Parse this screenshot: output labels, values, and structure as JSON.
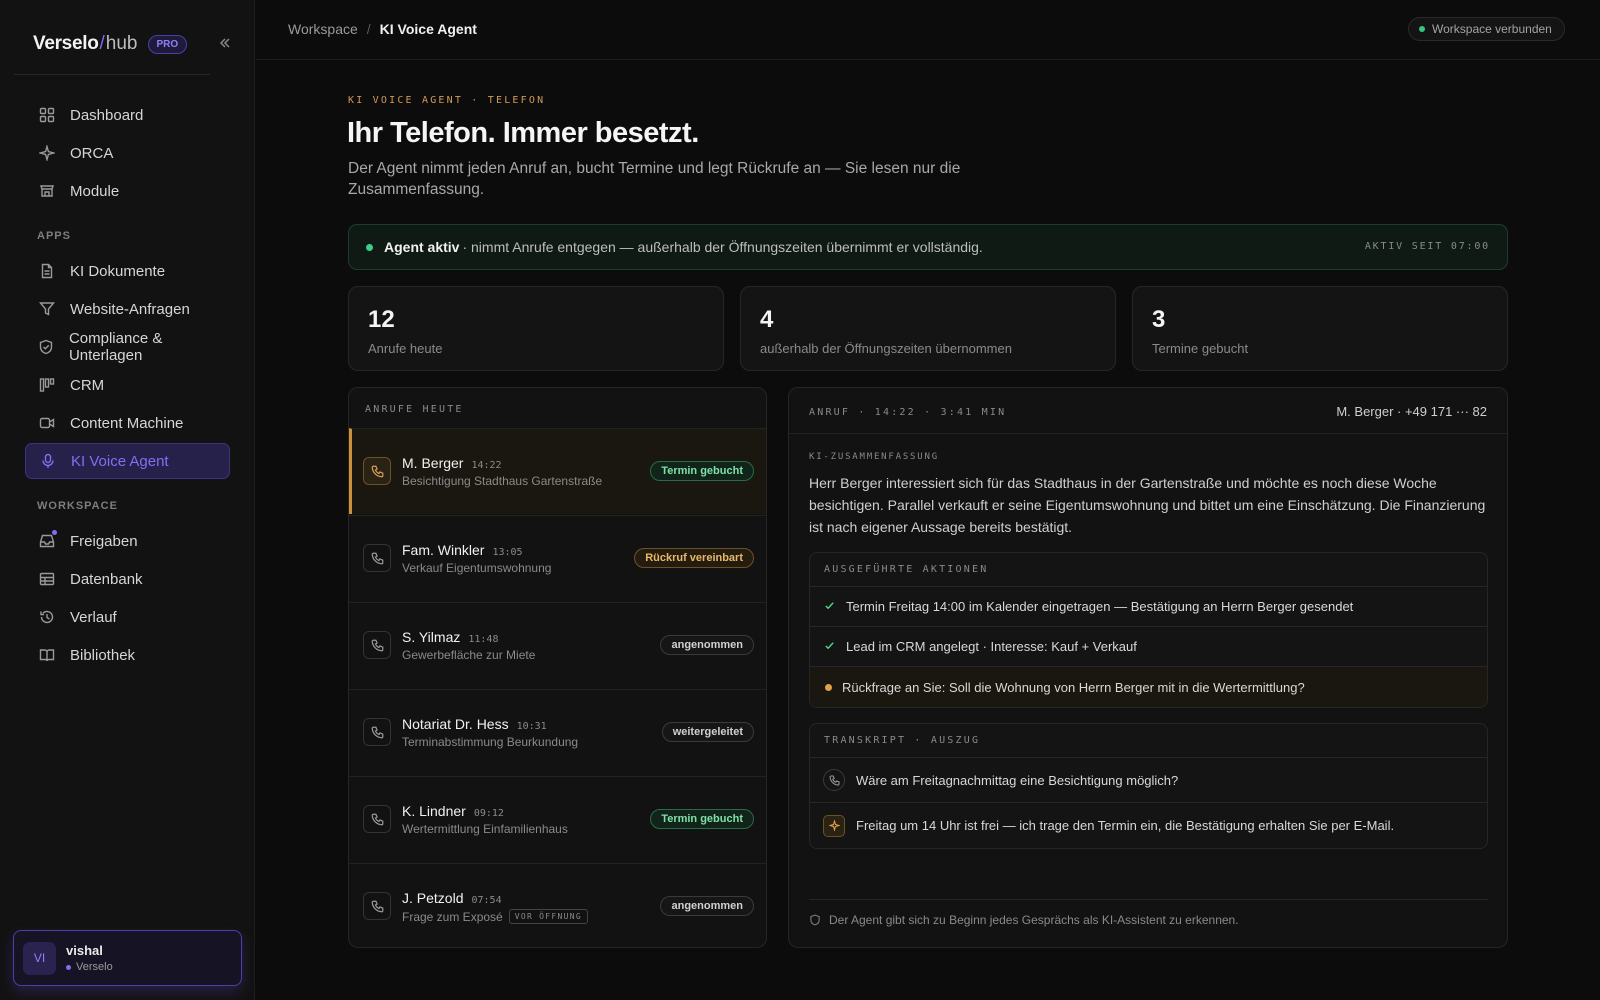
{
  "sidebar": {
    "brand": {
      "name": "Verselo",
      "slash": "/",
      "suffix": "hub",
      "badge": "PRO"
    },
    "collapse_icon": "chevrons-left-icon",
    "main_items": [
      {
        "label": "Dashboard",
        "icon": "grid-icon"
      },
      {
        "label": "ORCA",
        "icon": "sparkle-icon"
      },
      {
        "label": "Module",
        "icon": "store-icon"
      }
    ],
    "apps_title": "APPS",
    "apps_items": [
      {
        "label": "KI Dokumente",
        "icon": "document-icon"
      },
      {
        "label": "Website-Anfragen",
        "icon": "filter-icon"
      },
      {
        "label": "Compliance & Unterlagen",
        "icon": "shield-check-icon"
      },
      {
        "label": "CRM",
        "icon": "kanban-icon"
      },
      {
        "label": "Content Machine",
        "icon": "video-icon"
      },
      {
        "label": "KI Voice Agent",
        "icon": "microphone-icon",
        "active": true
      }
    ],
    "workspace_title": "WORKSPACE",
    "workspace_items": [
      {
        "label": "Freigaben",
        "icon": "inbox-icon"
      },
      {
        "label": "Datenbank",
        "icon": "table-icon"
      },
      {
        "label": "Verlauf",
        "icon": "history-icon"
      },
      {
        "label": "Bibliothek",
        "icon": "book-icon"
      }
    ],
    "user": {
      "initials": "VI",
      "name": "vishal",
      "org": "Verselo"
    }
  },
  "topbar": {
    "breadcrumb_root": "Workspace",
    "breadcrumb_sep": "/",
    "breadcrumb_current": "KI Voice Agent",
    "status": "Workspace verbunden",
    "status_color": "#34c77b"
  },
  "header": {
    "eyebrow": "KI VOICE AGENT · TELEFON",
    "title": "Ihr Telefon. Immer besetzt.",
    "subtitle": "Der Agent nimmt jeden Anruf an, bucht Termine und legt Rückrufe an — Sie lesen nur die Zusammenfassung."
  },
  "status_banner": {
    "strong": "Agent aktiv",
    "rest": "· nimmt Anrufe entgegen — außerhalb der Öffnungszeiten übernimmt er vollständig.",
    "since": "AKTIV SEIT 07:00"
  },
  "stats": [
    {
      "value": "12",
      "label": "Anrufe heute"
    },
    {
      "value": "4",
      "label": "außerhalb der Öffnungszeiten übernommen"
    },
    {
      "value": "3",
      "label": "Termine gebucht"
    }
  ],
  "calls": {
    "title": "ANRUFE HEUTE",
    "items": [
      {
        "name": "M. Berger",
        "time": "14:22",
        "desc": "Besichtigung Stadthaus Gartenstraße",
        "badge": "Termin gebucht",
        "badge_type": "green",
        "selected": true
      },
      {
        "name": "Fam. Winkler",
        "time": "13:05",
        "desc": "Verkauf Eigentumswohnung",
        "badge": "Rückruf vereinbart",
        "badge_type": "amber"
      },
      {
        "name": "S. Yilmaz",
        "time": "11:48",
        "desc": "Gewerbefläche zur Miete",
        "badge": "angenommen",
        "badge_type": "neutral"
      },
      {
        "name": "Notariat Dr. Hess",
        "time": "10:31",
        "desc": "Terminabstimmung Beurkundung",
        "badge": "weitergeleitet",
        "badge_type": "neutral"
      },
      {
        "name": "K. Lindner",
        "time": "09:12",
        "desc": "Wertermittlung Einfamilienhaus",
        "badge": "Termin gebucht",
        "badge_type": "green"
      },
      {
        "name": "J. Petzold",
        "time": "07:54",
        "desc": "Frage zum Exposé",
        "tag": "VOR ÖFFNUNG",
        "badge": "angenommen",
        "badge_type": "neutral"
      }
    ]
  },
  "detail": {
    "head": "ANRUF · 14:22 · 3:41 MIN",
    "contact": "M. Berger · +49 171 ··· 82",
    "summary_title": "KI-ZUSAMMENFASSUNG",
    "summary": "Herr Berger interessiert sich für das Stadthaus in der Gartenstraße und möchte es noch diese Woche besichtigen. Parallel verkauft er seine Eigentumswohnung und bittet um eine Einschätzung. Die Finanzierung ist nach eigener Aussage bereits bestätigt.",
    "actions_title": "AUSGEFÜHRTE AKTIONEN",
    "actions": [
      {
        "text": "Termin Freitag 14:00 im Kalender eingetragen — Bestätigung an Herrn Berger gesendet",
        "state": "done"
      },
      {
        "text": "Lead im CRM angelegt · Interesse: Kauf + Verkauf",
        "state": "done"
      },
      {
        "text": "Rückfrage an Sie: Soll die Wohnung von Herrn Berger mit in die Wertermittlung?",
        "state": "pending"
      }
    ],
    "transcript_title": "TRANSKRIPT · AUSZUG",
    "transcript": [
      {
        "speaker": "caller",
        "icon": "phone-icon",
        "text": "Wäre am Freitagnachmittag eine Besichtigung möglich?"
      },
      {
        "speaker": "agent",
        "icon": "sparkle-icon",
        "text": "Freitag um 14 Uhr ist frei — ich trage den Termin ein, die Bestätigung erhalten Sie per E-Mail."
      }
    ],
    "footer": "Der Agent gibt sich zu Beginn jedes Gesprächs als KI-Assistent zu erkennen."
  }
}
